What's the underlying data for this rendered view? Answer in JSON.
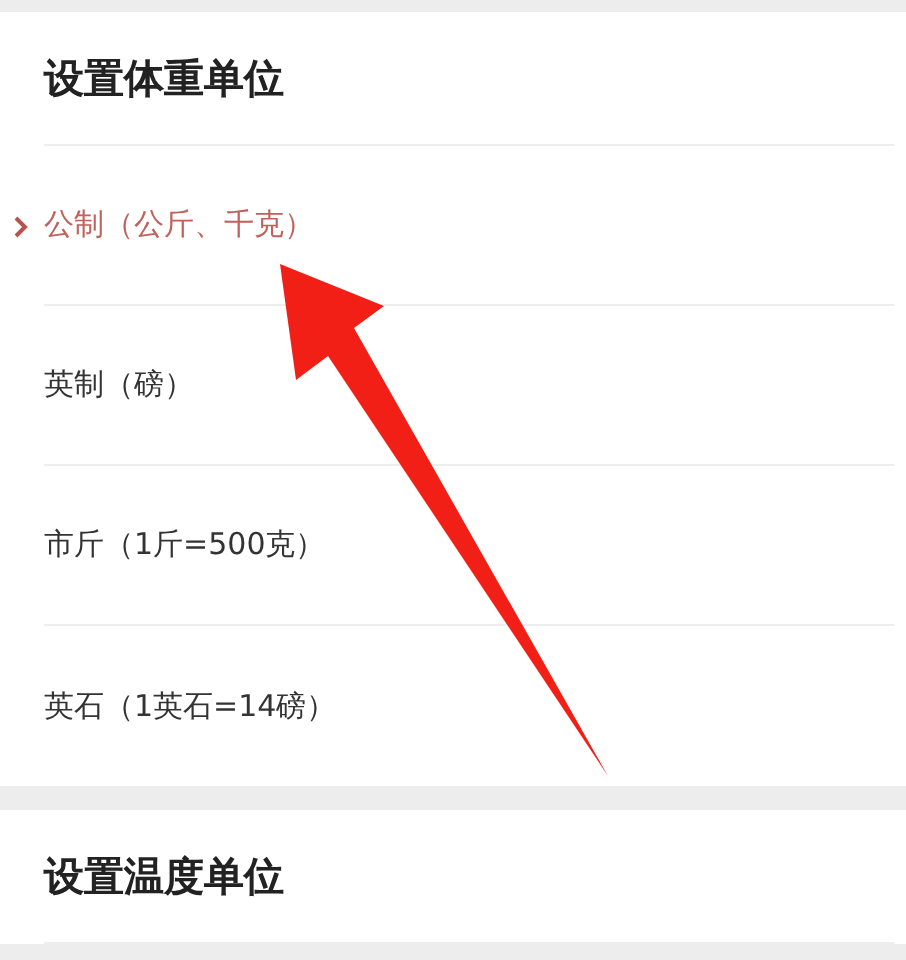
{
  "sections": [
    {
      "title": "设置体重单位",
      "options": [
        {
          "label": "公制（公斤、千克）",
          "selected": true
        },
        {
          "label": "英制（磅）",
          "selected": false
        },
        {
          "label": "市斤（1斤=500克）",
          "selected": false
        },
        {
          "label": "英石（1英石=14磅）",
          "selected": false
        }
      ]
    },
    {
      "title": "设置温度单位"
    }
  ]
}
